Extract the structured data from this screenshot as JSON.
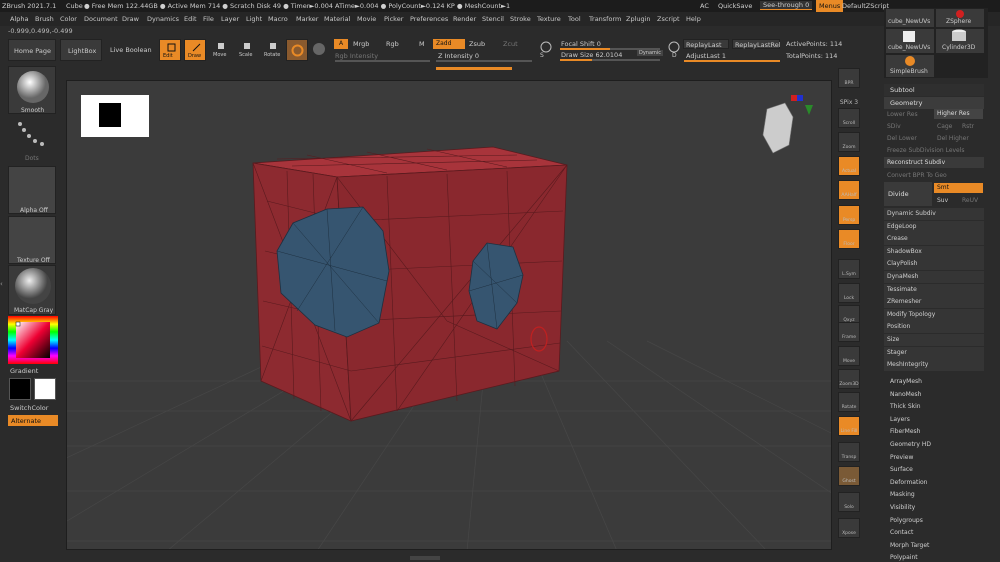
{
  "titlebar": {
    "app": "ZBrush 2021.7.1",
    "doc": "Cube",
    "stats": "● Free Mem 122.44GB ● Active Mem 714 ● Scratch Disk 49 ● Timer►0.004 ATime►0.004 ● PolyCount►0.124 KP ● MeshCount►1",
    "ac": "AC",
    "quicksave": "QuickSave",
    "seethrough": "See-through",
    "seethrough_val": "0",
    "menus": "Menus",
    "defaultzscript": "DefaultZScript"
  },
  "menubar": [
    "Alpha",
    "Brush",
    "Color",
    "Document",
    "Draw",
    "Dynamics",
    "Edit",
    "File",
    "Layer",
    "Light",
    "Macro",
    "Marker",
    "Material",
    "Movie",
    "Picker",
    "Preferences",
    "Render",
    "Stencil",
    "Stroke",
    "Texture",
    "Tool",
    "Transform",
    "Zplugin",
    "Zscript",
    "Help"
  ],
  "coords": "-0.999,0.499,-0.499",
  "toolbar": {
    "home": "Home Page",
    "lightbox": "LightBox",
    "liveboolean": "Live Boolean",
    "edit": "Edit",
    "draw": "Draw",
    "move": "Move",
    "scale": "Scale",
    "rotate": "Rotate",
    "a": "A",
    "mrgb": "Mrgb",
    "rgb": "Rgb",
    "m": "M",
    "zadd": "Zadd",
    "zsub": "Zsub",
    "zcut": "Zcut",
    "rgb_intensity": "Rgb Intensity",
    "z_intensity": "Z Intensity 0",
    "focal": "Focal Shift 0",
    "drawsize": "Draw Size 62.0104",
    "dynamic": "Dynamic",
    "s": "S",
    "d": "D",
    "replaylast": "ReplayLast",
    "replaylastrel": "ReplayLastRel",
    "adjustlast": "AdjustLast 1",
    "activepoints": "ActivePoints: 114",
    "totalpoints": "TotalPoints: 114"
  },
  "leftshelf": {
    "smooth": "Smooth",
    "dots": "Dots",
    "alpha": "Alpha Off",
    "texture": "Texture Off",
    "matcap": "MatCap Gray",
    "gradient": "Gradient",
    "switchcolor": "SwitchColor",
    "alternate": "Alternate"
  },
  "rightshelf": [
    "BPR",
    "SPix 3",
    "Scroll",
    "Zoom",
    "Actual",
    "AAHalf",
    "Persp",
    "Floor",
    "L.Sym",
    "Lock",
    "Qxyz",
    "Frame",
    "Move",
    "Zoom3D",
    "Rotate",
    "Line Fill",
    "Transp",
    "Ghost",
    "Solo",
    "Xpose"
  ],
  "toolthumbs": {
    "cube_newuvs1": "cube_NewUVs",
    "zsphere": "ZSphere",
    "cube_newuvs2": "cube_NewUVs",
    "cylinder": "Cylinder3D",
    "simplebrush": "SimpleBrush"
  },
  "panel": {
    "subtool": "Subtool",
    "geometry": "Geometry",
    "lowerres": "Lower Res",
    "higherres": "Higher Res",
    "sdiv": "SDiv",
    "cage": "Cage",
    "rstr": "Rstr",
    "dellower": "Del Lower",
    "delhigher": "Del Higher",
    "freeze": "Freeze SubDivision Levels",
    "reconstruct": "Reconstruct Subdiv",
    "convertbpr": "Convert BPR To Geo",
    "divide": "Divide",
    "smt": "Smt",
    "suv": "Suv",
    "reuv": "ReUV",
    "items": [
      "Dynamic Subdiv",
      "EdgeLoop",
      "Crease",
      "ShadowBox",
      "ClayPolish",
      "DynaMesh",
      "Tessimate",
      "ZRemesher",
      "Modify Topology",
      "Position",
      "Size",
      "Stager",
      "MeshIntegrity"
    ],
    "sub": [
      "ArrayMesh",
      "NanoMesh",
      "Thick Skin",
      "Layers",
      "FiberMesh",
      "Geometry HD",
      "Preview",
      "Surface",
      "Deformation",
      "Masking",
      "Visibility",
      "Polygroups",
      "Contact",
      "Morph Target",
      "Polypaint"
    ]
  },
  "colors": {
    "accent": "#e98a26",
    "cube": "#8d2a30",
    "circle": "#3a5670",
    "bg": "#2b2b2b"
  }
}
